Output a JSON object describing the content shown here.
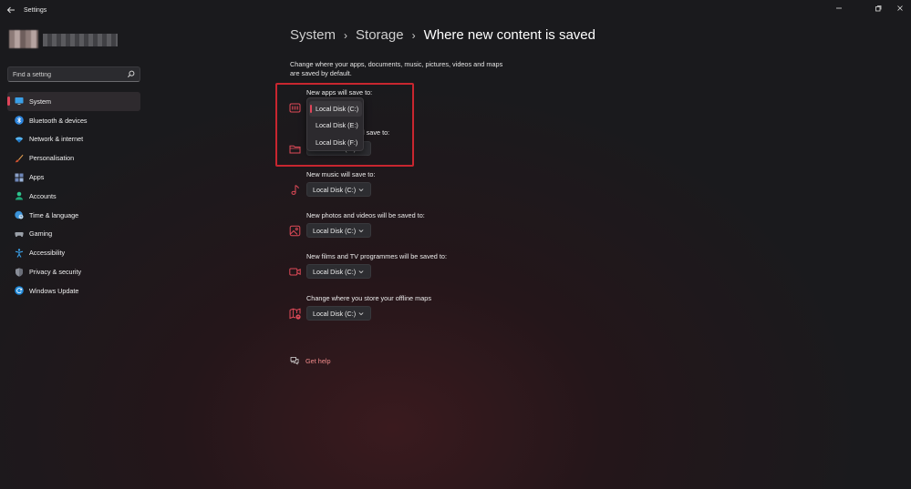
{
  "window": {
    "title": "Settings",
    "back_icon": "back-arrow-icon",
    "controls": [
      "minimize-icon",
      "maximize-icon",
      "close-icon"
    ]
  },
  "search": {
    "placeholder": "Find a setting",
    "icon": "search-icon"
  },
  "sidebar": {
    "items": [
      {
        "label": "System",
        "icon": "monitor-icon",
        "active": true
      },
      {
        "label": "Bluetooth & devices",
        "icon": "bluetooth-icon",
        "active": false
      },
      {
        "label": "Network & internet",
        "icon": "wifi-icon",
        "active": false
      },
      {
        "label": "Personalisation",
        "icon": "brush-icon",
        "active": false
      },
      {
        "label": "Apps",
        "icon": "apps-icon",
        "active": false
      },
      {
        "label": "Accounts",
        "icon": "person-icon",
        "active": false
      },
      {
        "label": "Time & language",
        "icon": "globe-clock-icon",
        "active": false
      },
      {
        "label": "Gaming",
        "icon": "gamepad-icon",
        "active": false
      },
      {
        "label": "Accessibility",
        "icon": "accessibility-icon",
        "active": false
      },
      {
        "label": "Privacy & security",
        "icon": "shield-icon",
        "active": false
      },
      {
        "label": "Windows Update",
        "icon": "update-icon",
        "active": false
      }
    ]
  },
  "breadcrumb": {
    "items": [
      "System",
      "Storage",
      "Where new content is saved"
    ],
    "separator": "›"
  },
  "description": "Change where your apps, documents, music, pictures, videos and maps are saved by default.",
  "settings": [
    {
      "label": "New apps will save to:",
      "value": "Local Disk (C:)",
      "icon": "apps-drive-icon"
    },
    {
      "label": "New documents will save to:",
      "value": "Local Disk (C:)",
      "icon": "folder-icon",
      "partial_label": "l save to:"
    },
    {
      "label": "New music will save to:",
      "value": "Local Disk (C:)",
      "icon": "music-note-icon"
    },
    {
      "label": "New photos and videos will be saved to:",
      "value": "Local Disk (C:)",
      "icon": "photo-icon"
    },
    {
      "label": "New films and TV programmes will be saved to:",
      "value": "Local Disk (C:)",
      "icon": "video-camera-icon"
    },
    {
      "label": "Change where you store your offline maps",
      "value": "Local Disk (C:)",
      "icon": "map-icon"
    }
  ],
  "popup": {
    "options": [
      "Local Disk (C:)",
      "Local Disk (E:)",
      "Local Disk (F:)"
    ],
    "selected_index": 0
  },
  "help": {
    "label": "Get help",
    "icon": "help-chat-icon"
  },
  "colors": {
    "accent": "#e0455a",
    "icon_red": "#e04a58",
    "highlight_box": "#c8262f",
    "link": "#f08a8a"
  }
}
